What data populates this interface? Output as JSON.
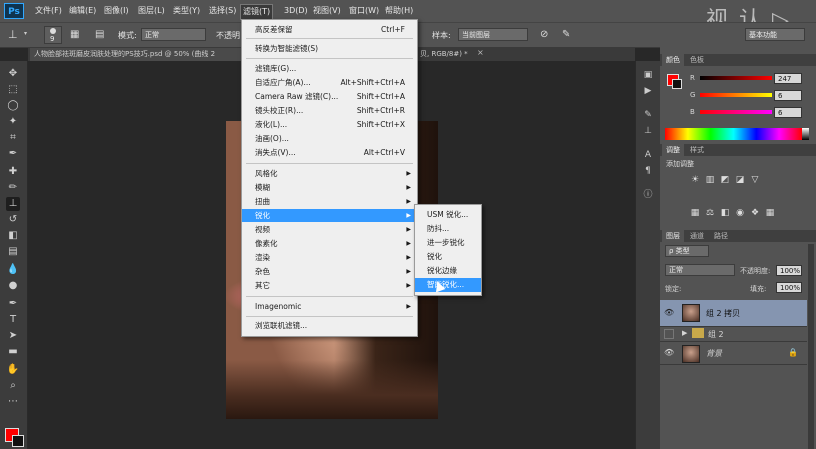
{
  "menubar": {
    "logo": "Ps",
    "items": [
      "文件(F)",
      "编辑(E)",
      "图像(I)",
      "图层(L)",
      "类型(Y)",
      "选择(S)",
      "滤镜(T)",
      "3D(D)",
      "视图(V)",
      "窗口(W)",
      "帮助(H)"
    ],
    "win_controls": [
      "−",
      "□",
      "×"
    ]
  },
  "watermark": "视 认 ▷",
  "options": {
    "brush_size": "9",
    "mode_label": "模式:",
    "mode_value": "正常",
    "opacity_label": "不透明",
    "sample_label": "样本:",
    "sample_value": "当前图层",
    "workspace": "基本功能"
  },
  "doc_tab": {
    "title": "人物脸部祛斑磨皮润肤处理的PS技巧.psd @ 50% (曲线 2",
    "title2": "贝, RGB/8#) *",
    "close": "×"
  },
  "filter_menu": {
    "items": [
      {
        "label": "高反差保留",
        "shortcut": "Ctrl+F"
      },
      {
        "label": "转换为智能滤镜(S)",
        "shortcut": ""
      },
      {
        "label": "滤镜库(G)...",
        "shortcut": ""
      },
      {
        "label": "自适应广角(A)...",
        "shortcut": "Alt+Shift+Ctrl+A"
      },
      {
        "label": "Camera Raw 滤镜(C)...",
        "shortcut": "Shift+Ctrl+A"
      },
      {
        "label": "镜头校正(R)...",
        "shortcut": "Shift+Ctrl+R"
      },
      {
        "label": "液化(L)...",
        "shortcut": "Shift+Ctrl+X"
      },
      {
        "label": "油画(O)...",
        "shortcut": ""
      },
      {
        "label": "消失点(V)...",
        "shortcut": "Alt+Ctrl+V"
      },
      {
        "label": "风格化",
        "shortcut": ""
      },
      {
        "label": "模糊",
        "shortcut": ""
      },
      {
        "label": "扭曲",
        "shortcut": ""
      },
      {
        "label": "锐化",
        "shortcut": ""
      },
      {
        "label": "视频",
        "shortcut": ""
      },
      {
        "label": "像素化",
        "shortcut": ""
      },
      {
        "label": "渲染",
        "shortcut": ""
      },
      {
        "label": "杂色",
        "shortcut": ""
      },
      {
        "label": "其它",
        "shortcut": ""
      },
      {
        "label": "Imagenomic",
        "shortcut": ""
      },
      {
        "label": "浏览联机滤镜...",
        "shortcut": ""
      }
    ]
  },
  "sharpen_submenu": [
    "USM 锐化...",
    "防抖...",
    "进一步锐化",
    "锐化",
    "锐化边缘",
    "智能锐化..."
  ],
  "color_panel": {
    "tabs": [
      "颜色",
      "色板"
    ],
    "r_label": "R",
    "g_label": "G",
    "b_label": "B",
    "r_value": "247",
    "g_value": "6",
    "b_value": "6"
  },
  "adjustments_panel": {
    "tabs": [
      "调整",
      "样式"
    ],
    "title": "添加调整"
  },
  "layers_panel": {
    "tabs": [
      "图层",
      "通道",
      "路径"
    ],
    "kind_filter": "ρ 类型",
    "blend_mode": "正常",
    "opacity_label": "不透明度:",
    "opacity_value": "100%",
    "lock_label": "锁定:",
    "fill_label": "填充:",
    "fill_value": "100%",
    "layers": [
      {
        "name": "组 2 拷贝",
        "selected": true
      },
      {
        "name": "组 2",
        "selected": false
      },
      {
        "name": "背景",
        "selected": false
      }
    ]
  },
  "colors": {
    "foreground": "#ff0000",
    "background": "#111111",
    "menu_highlight": "#3399ff"
  }
}
